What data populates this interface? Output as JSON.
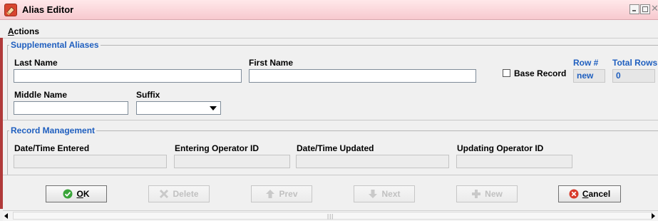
{
  "window": {
    "title": "Alias Editor",
    "title_bar_color": "#f7c9cf",
    "accent_color": "#1f5fbf"
  },
  "menu": {
    "actions_first": "A",
    "actions_rest": "ctions"
  },
  "supplemental": {
    "section_title": "Supplemental Aliases",
    "last_name_label": "Last Name",
    "last_name_value": "",
    "first_name_label": "First Name",
    "first_name_value": "",
    "middle_name_label": "Middle Name",
    "middle_name_value": "",
    "suffix_label": "Suffix",
    "suffix_value": "",
    "base_record_label": "Base Record",
    "base_record_checked": false,
    "row_label": "Row #",
    "row_value": "new",
    "total_rows_label": "Total Rows",
    "total_rows_value": "0"
  },
  "record_management": {
    "section_title": "Record Management",
    "date_entered_label": "Date/Time Entered",
    "date_entered_value": "",
    "entering_operator_label": "Entering Operator ID",
    "entering_operator_value": "",
    "date_updated_label": "Date/Time Updated",
    "date_updated_value": "",
    "updating_operator_label": "Updating Operator ID",
    "updating_operator_value": ""
  },
  "buttons": {
    "ok_first": "O",
    "ok_rest": "K",
    "delete_label": "Delete",
    "prev_label": "Prev",
    "next_label": "Next",
    "new_label": "New",
    "cancel_first": "C",
    "cancel_rest": "ancel"
  },
  "icons": {
    "app": "alias-editor-app-icon",
    "ok": "green-check-icon",
    "delete": "x-icon",
    "prev": "arrow-up-icon",
    "next": "arrow-down-icon",
    "new": "plus-icon",
    "cancel": "red-x-circle-icon"
  }
}
